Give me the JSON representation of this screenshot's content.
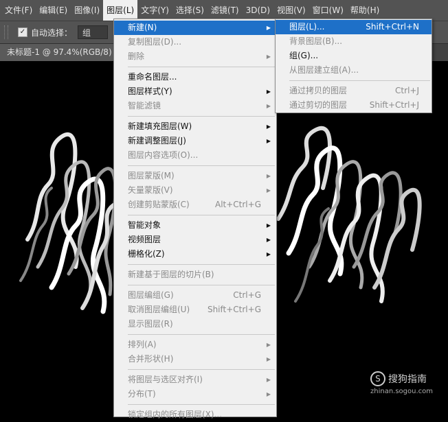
{
  "menubar": {
    "items": [
      "文件(F)",
      "编辑(E)",
      "图像(I)",
      "图层(L)",
      "文字(Y)",
      "选择(S)",
      "滤镜(T)",
      "3D(D)",
      "视图(V)",
      "窗口(W)",
      "帮助(H)"
    ]
  },
  "options": {
    "auto_select_label": "自动选择：",
    "checkbox_mark": "✓",
    "select_value": "组"
  },
  "document_tab": {
    "title": "未标题-1 @ 97.4%(RGB/8) *"
  },
  "layer_menu": {
    "items": [
      {
        "label": "新建(N)",
        "shortcut": "",
        "submenu": true
      },
      {
        "label": "复制图层(D)...",
        "shortcut": "",
        "submenu": false
      },
      {
        "label": "删除",
        "shortcut": "",
        "submenu": true
      },
      {
        "label": "重命名图层...",
        "shortcut": "",
        "submenu": false
      },
      {
        "label": "图层样式(Y)",
        "shortcut": "",
        "submenu": true
      },
      {
        "label": "智能滤镜",
        "shortcut": "",
        "submenu": true
      },
      {
        "label": "新建填充图层(W)",
        "shortcut": "",
        "submenu": true
      },
      {
        "label": "新建调整图层(J)",
        "shortcut": "",
        "submenu": true
      },
      {
        "label": "图层内容选项(O)...",
        "shortcut": "",
        "submenu": false
      },
      {
        "label": "图层蒙版(M)",
        "shortcut": "",
        "submenu": true
      },
      {
        "label": "矢量蒙版(V)",
        "shortcut": "",
        "submenu": true
      },
      {
        "label": "创建剪贴蒙版(C)",
        "shortcut": "Alt+Ctrl+G",
        "submenu": false
      },
      {
        "label": "智能对象",
        "shortcut": "",
        "submenu": true
      },
      {
        "label": "视频图层",
        "shortcut": "",
        "submenu": true
      },
      {
        "label": "栅格化(Z)",
        "shortcut": "",
        "submenu": true
      },
      {
        "label": "新建基于图层的切片(B)",
        "shortcut": "",
        "submenu": false
      },
      {
        "label": "图层编组(G)",
        "shortcut": "Ctrl+G",
        "submenu": false
      },
      {
        "label": "取消图层编组(U)",
        "shortcut": "Shift+Ctrl+G",
        "submenu": false
      },
      {
        "label": "显示图层(R)",
        "shortcut": "",
        "submenu": false
      },
      {
        "label": "排列(A)",
        "shortcut": "",
        "submenu": true
      },
      {
        "label": "合并形状(H)",
        "shortcut": "",
        "submenu": true
      },
      {
        "label": "将图层与选区对齐(I)",
        "shortcut": "",
        "submenu": true
      },
      {
        "label": "分布(T)",
        "shortcut": "",
        "submenu": true
      },
      {
        "label": "锁定组内的所有图层(X)...",
        "shortcut": "",
        "submenu": false
      }
    ]
  },
  "new_submenu": {
    "items": [
      {
        "label": "图层(L)...",
        "shortcut": "Shift+Ctrl+N"
      },
      {
        "label": "背景图层(B)...",
        "shortcut": ""
      },
      {
        "label": "组(G)...",
        "shortcut": ""
      },
      {
        "label": "从图层建立组(A)...",
        "shortcut": ""
      },
      {
        "label": "通过拷贝的图层",
        "shortcut": "Ctrl+J"
      },
      {
        "label": "通过剪切的图层",
        "shortcut": "Shift+Ctrl+J"
      }
    ]
  },
  "watermark": {
    "brand": "搜狗指南",
    "url": "zhinan.sogou.com",
    "icon_glyph": "S"
  },
  "colors": {
    "menubar": "#535353",
    "menu_bg": "#f0f0f0",
    "highlight": "#1e70c8",
    "disabled": "#8a8a8a"
  }
}
